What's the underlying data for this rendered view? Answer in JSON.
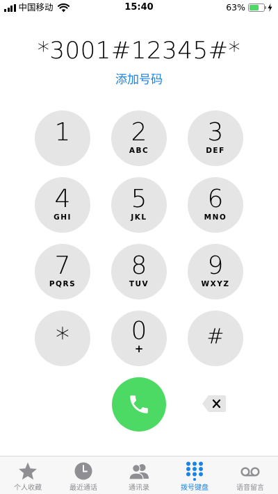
{
  "status_bar": {
    "carrier": "中国移动",
    "time": "15:40",
    "battery_percent": "63%",
    "battery_level": 0.63,
    "icons": [
      "signal-icon",
      "wifi-icon",
      "battery-icon",
      "charging-bolt-icon"
    ]
  },
  "dial": {
    "number": "*3001#12345#*",
    "add_number_label": "添加号码"
  },
  "keypad": {
    "keys": [
      {
        "digit": "1",
        "letters": ""
      },
      {
        "digit": "2",
        "letters": "ABC"
      },
      {
        "digit": "3",
        "letters": "DEF"
      },
      {
        "digit": "4",
        "letters": "GHI"
      },
      {
        "digit": "5",
        "letters": "JKL"
      },
      {
        "digit": "6",
        "letters": "MNO"
      },
      {
        "digit": "7",
        "letters": "PQRS"
      },
      {
        "digit": "8",
        "letters": "TUV"
      },
      {
        "digit": "9",
        "letters": "WXYZ"
      },
      {
        "digit": "*",
        "letters": ""
      },
      {
        "digit": "0",
        "letters": "+"
      },
      {
        "digit": "#",
        "letters": ""
      }
    ],
    "call_icon": "phone-icon",
    "delete_icon": "backspace-icon"
  },
  "tab_bar": {
    "tabs": [
      {
        "label": "个人收藏",
        "icon": "star-icon",
        "active": false
      },
      {
        "label": "最近通话",
        "icon": "clock-icon",
        "active": false
      },
      {
        "label": "通讯录",
        "icon": "contacts-icon",
        "active": false
      },
      {
        "label": "拨号键盘",
        "icon": "keypad-icon",
        "active": true
      },
      {
        "label": "语音留言",
        "icon": "voicemail-icon",
        "active": false
      }
    ]
  },
  "colors": {
    "accent": "#1a83e6",
    "call_green": "#4cd964",
    "key_background": "#e5e5e5",
    "inactive_tab": "#8e8e93"
  }
}
